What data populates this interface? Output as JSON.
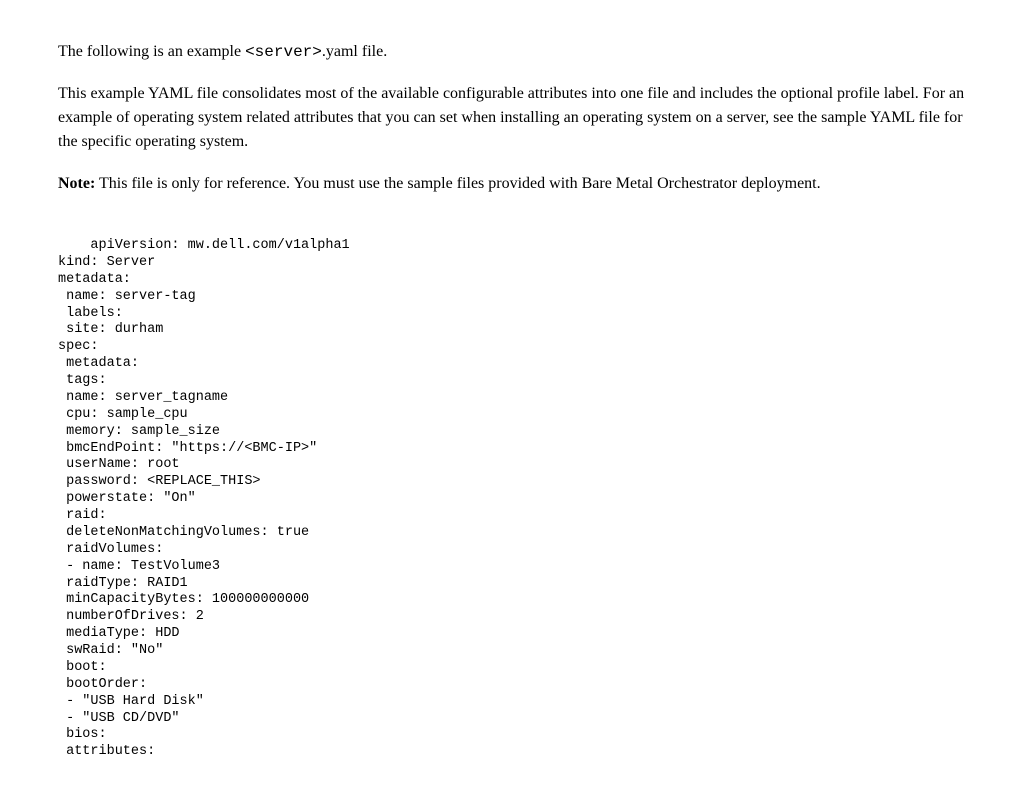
{
  "intro": {
    "prefix": "The following is an example ",
    "code": "<server>",
    "suffix": ".yaml file."
  },
  "description": "This example YAML file consolidates most of the available configurable attributes into one file and includes the optional profile label. For an example of operating system related attributes that you can set when installing an operating system on a server, see the sample YAML file for the specific operating system.",
  "note": {
    "label": "Note:",
    "text": " This file is only for reference. You must use the sample files provided with Bare Metal Orchestrator deployment."
  },
  "code": "    apiVersion: mw.dell.com/v1alpha1\nkind: Server\nmetadata:\n name: server-tag\n labels:\n site: durham\nspec:\n metadata:\n tags:\n name: server_tagname\n cpu: sample_cpu\n memory: sample_size\n bmcEndPoint: \"https://<BMC-IP>\"\n userName: root\n password: <REPLACE_THIS>\n powerstate: \"On\"\n raid:\n deleteNonMatchingVolumes: true\n raidVolumes:\n - name: TestVolume3\n raidType: RAID1\n minCapacityBytes: 100000000000\n numberOfDrives: 2\n mediaType: HDD\n swRaid: \"No\"\n boot:\n bootOrder:\n - \"USB Hard Disk\"\n - \"USB CD/DVD\"\n bios:\n attributes:"
}
